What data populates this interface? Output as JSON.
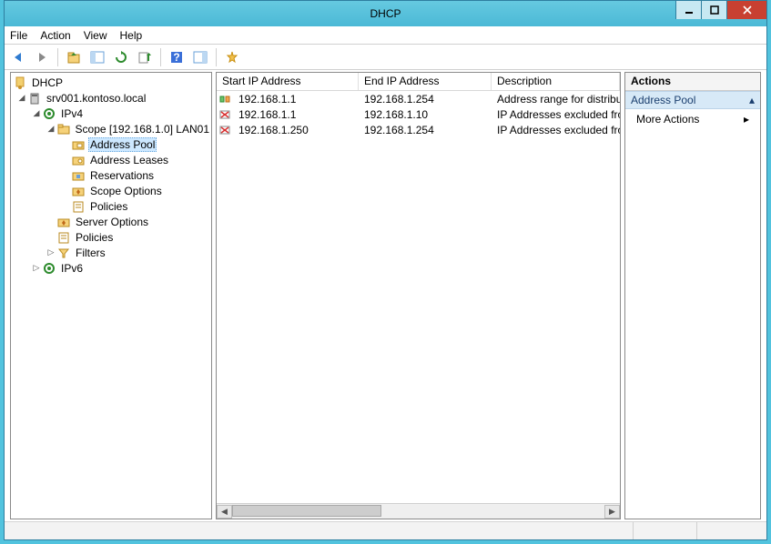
{
  "window": {
    "title": "DHCP"
  },
  "menu": {
    "file": "File",
    "action": "Action",
    "view": "View",
    "help": "Help"
  },
  "tree": {
    "root": "DHCP",
    "server": "srv001.kontoso.local",
    "ipv4": "IPv4",
    "scope": "Scope [192.168.1.0] LAN01",
    "address_pool": "Address Pool",
    "address_leases": "Address Leases",
    "reservations": "Reservations",
    "scope_options": "Scope Options",
    "policies_scope": "Policies",
    "server_options": "Server Options",
    "policies_server": "Policies",
    "filters": "Filters",
    "ipv6": "IPv6"
  },
  "list": {
    "columns": {
      "start": "Start IP Address",
      "end": "End IP Address",
      "desc": "Description"
    },
    "rows": [
      {
        "kind": "range",
        "start": "192.168.1.1",
        "end": "192.168.1.254",
        "desc": "Address range for distribution"
      },
      {
        "kind": "exclude",
        "start": "192.168.1.1",
        "end": "192.168.1.10",
        "desc": "IP Addresses excluded from distribution"
      },
      {
        "kind": "exclude",
        "start": "192.168.1.250",
        "end": "192.168.1.254",
        "desc": "IP Addresses excluded from distribution"
      }
    ]
  },
  "actions": {
    "header": "Actions",
    "section": "Address Pool",
    "more": "More Actions"
  }
}
